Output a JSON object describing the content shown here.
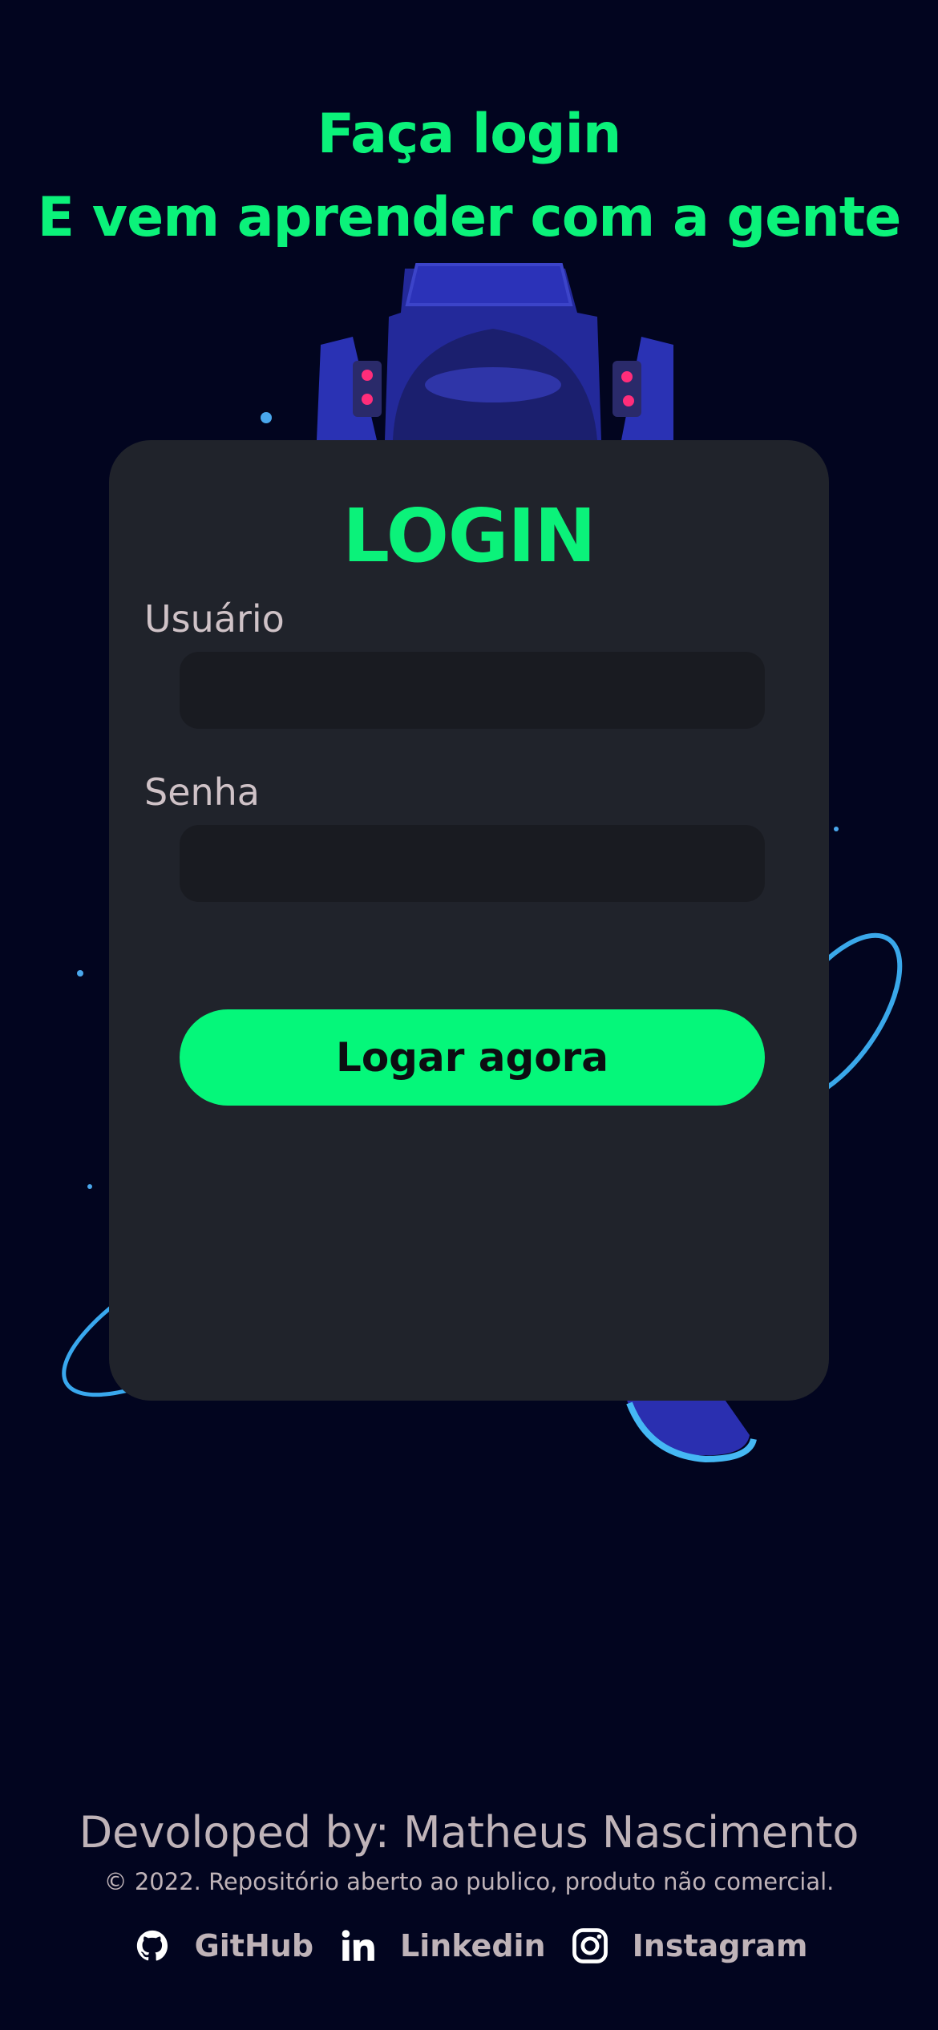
{
  "header": {
    "line1": "Faça login",
    "line2": "E vem aprender com a gente"
  },
  "login_card": {
    "title": "LOGIN",
    "username_label": "Usuário",
    "username_value": "",
    "password_label": "Senha",
    "password_value": "",
    "submit_label": "Logar agora"
  },
  "footer": {
    "credit": "Devoloped by: Matheus Nascimento",
    "copyright": "© 2022. Repositório aberto ao publico, produto não comercial.",
    "links": [
      {
        "label": "GitHub",
        "icon": "github-icon"
      },
      {
        "label": "Linkedin",
        "icon": "linkedin-icon"
      },
      {
        "label": "Instagram",
        "icon": "instagram-icon"
      }
    ]
  },
  "colors": {
    "background": "#02051f",
    "accent": "#0bf27a",
    "card": "#20232b",
    "input": "#191b21",
    "button": "#05f77a",
    "muted_text": "#bfb3b8"
  }
}
